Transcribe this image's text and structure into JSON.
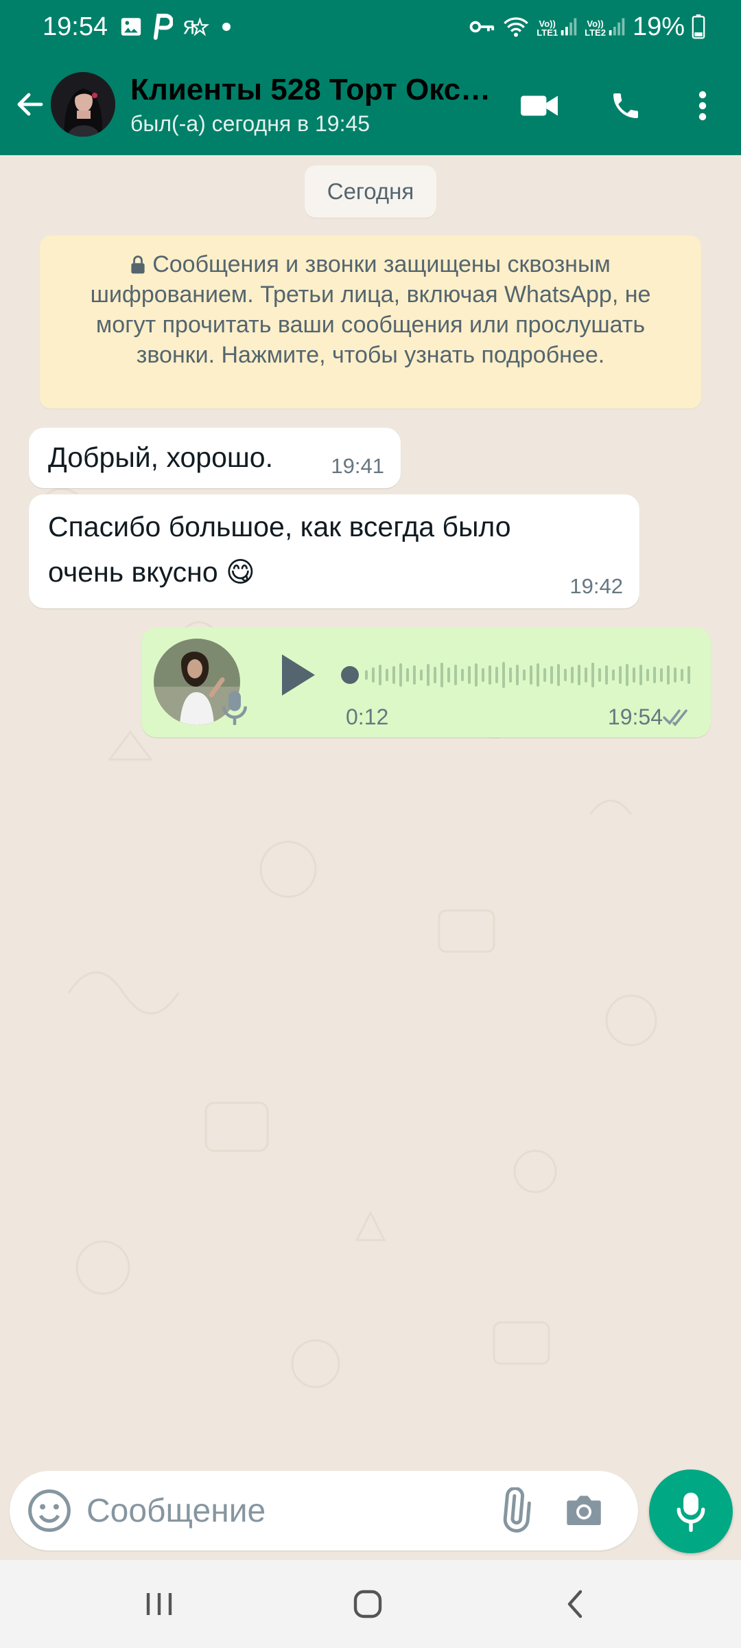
{
  "status_bar": {
    "time": "19:54",
    "battery_text": "19%",
    "icons": [
      "image-icon",
      "parking-app-icon",
      "yandex-icon",
      "dot-icon",
      "vpn-key-icon",
      "wifi-icon",
      "volte-lte1-signal-icon",
      "volte-lte2-signal-icon",
      "battery-icon"
    ],
    "sim1_label": "LTE1",
    "sim2_label": "LTE2",
    "volte_label": "Vo))"
  },
  "header": {
    "title": "Клиенты 528 Торт Окс…",
    "subtitle": "был(-а) сегодня в 19:45",
    "color": "#008069"
  },
  "chat": {
    "date_label": "Сегодня",
    "encryption_notice": "Сообщения и звонки защищены сквозным шифрованием. Третьи лица, включая WhatsApp, не могут прочитать ваши сообщения или прослушать звонки. Нажмите, чтобы узнать подробнее.",
    "messages": [
      {
        "direction": "incoming",
        "text": "Добрый, хорошо.",
        "time": "19:41"
      },
      {
        "direction": "incoming",
        "text": "Спасибо большое, как всегда было очень вкусно 😋",
        "time": "19:42"
      },
      {
        "direction": "outgoing",
        "type": "voice",
        "duration": "0:12",
        "time": "19:54",
        "status": "read"
      }
    ]
  },
  "input_bar": {
    "placeholder": "Сообщение"
  },
  "colors": {
    "accent": "#00a884",
    "outgoing_bubble": "#dcf8c6",
    "chat_background": "#efe7dd"
  }
}
